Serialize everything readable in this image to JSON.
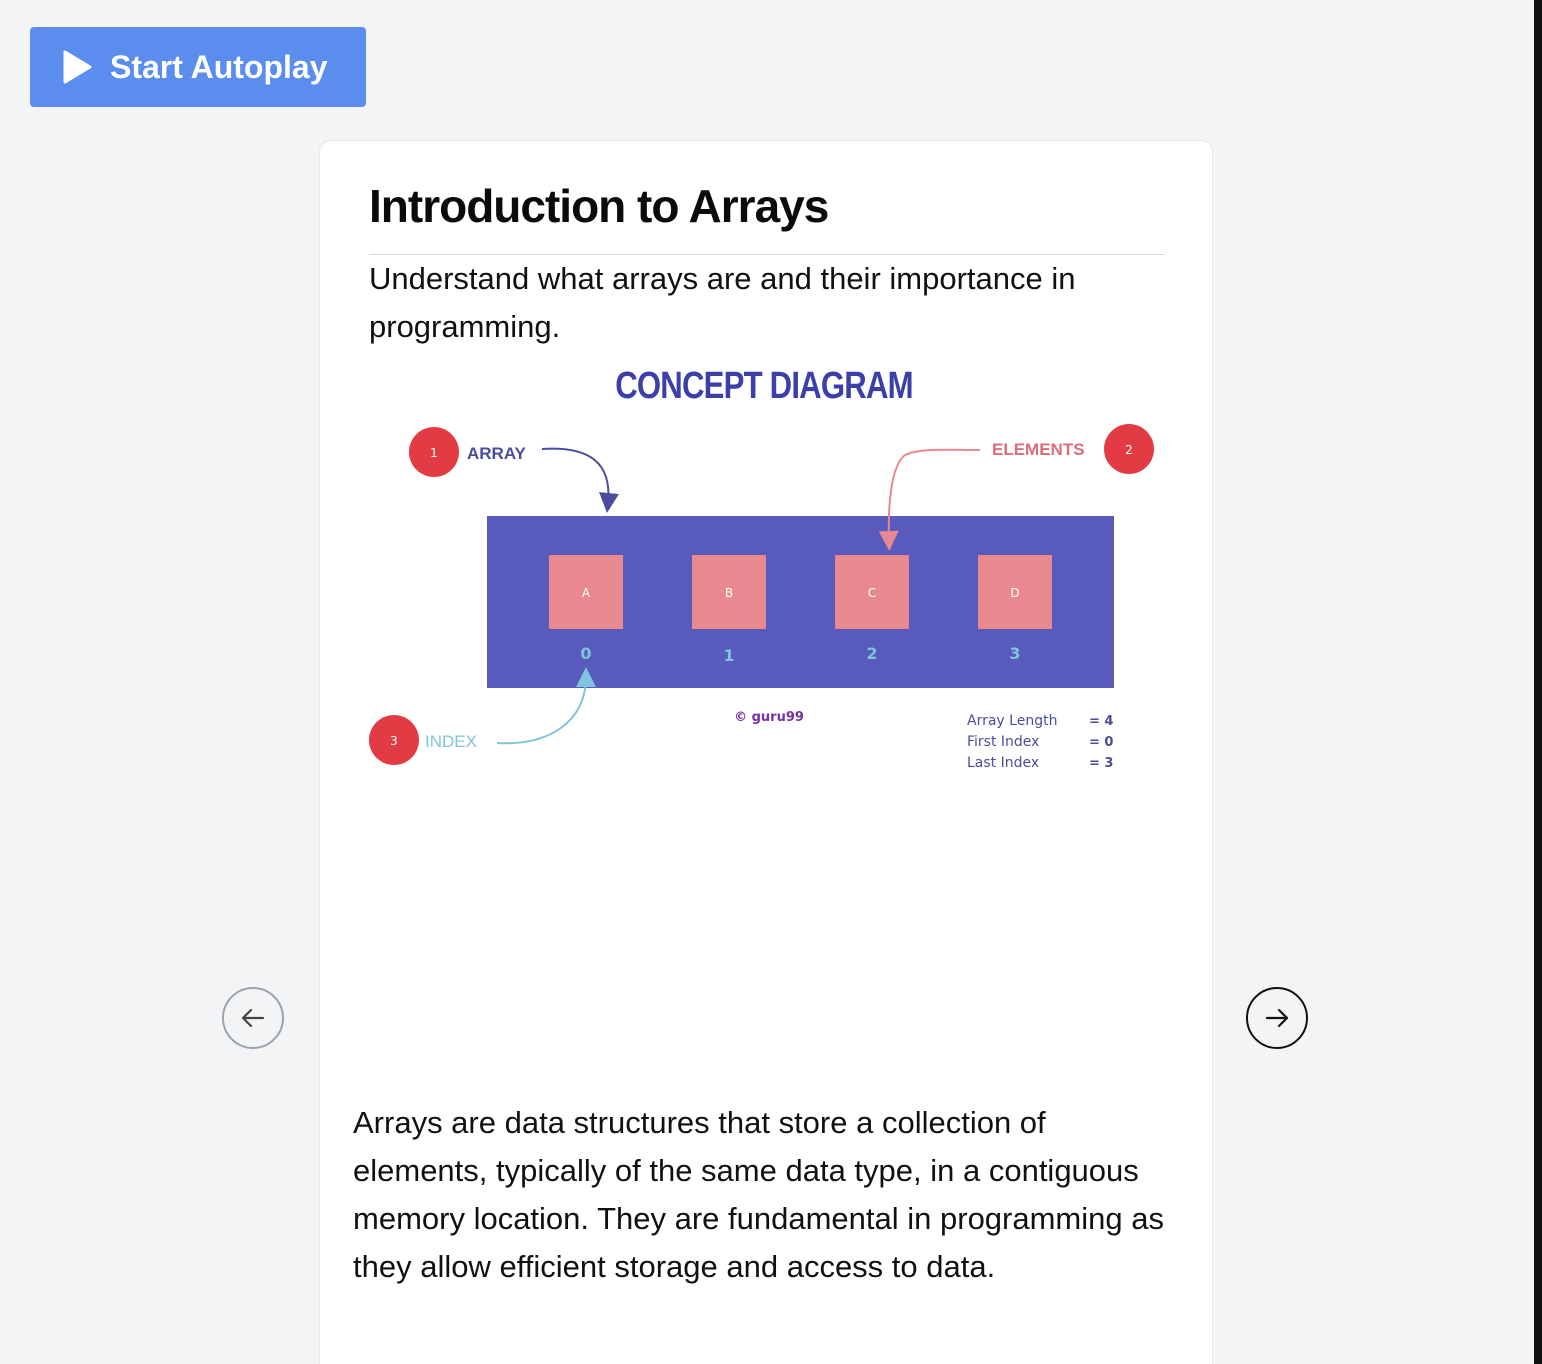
{
  "toolbar": {
    "autoplay_label": "Start Autoplay",
    "autoplay_icon": "play-icon"
  },
  "slide": {
    "title": "Introduction to Arrays",
    "subtitle": "Understand what arrays are and their importance in programming.",
    "body": "Arrays are data structures that store a collection of elements, typically of the same data type, in a contiguous memory location. They are fundamental in programming as they allow efficient storage and access to data."
  },
  "diagram": {
    "title": "CONCEPT DIAGRAM",
    "callouts": [
      {
        "number": "1",
        "label": "ARRAY"
      },
      {
        "number": "2",
        "label": "ELEMENTS"
      },
      {
        "number": "3",
        "label": "INDEX"
      }
    ],
    "elements": [
      "A",
      "B",
      "C",
      "D"
    ],
    "indices": [
      "0",
      "1",
      "2",
      "3"
    ],
    "copyright": "© guru99",
    "stats": [
      {
        "label": "Array Length",
        "value": "= 4"
      },
      {
        "label": "First Index",
        "value": "= 0"
      },
      {
        "label": "Last Index",
        "value": "= 3"
      }
    ],
    "colors": {
      "array": "#585bbb",
      "element": "#e8888f",
      "badge": "#e23b43",
      "array_text": "#4a4d9e",
      "elements_text": "#d96d7a",
      "index_text": "#7fc4dc",
      "copyright_text": "#7a2fa3"
    }
  },
  "navigation": {
    "prev_icon": "arrow-left-icon",
    "next_icon": "arrow-right-icon"
  },
  "colors": {
    "accent": "#5b8def",
    "background": "#f3f4f6"
  }
}
